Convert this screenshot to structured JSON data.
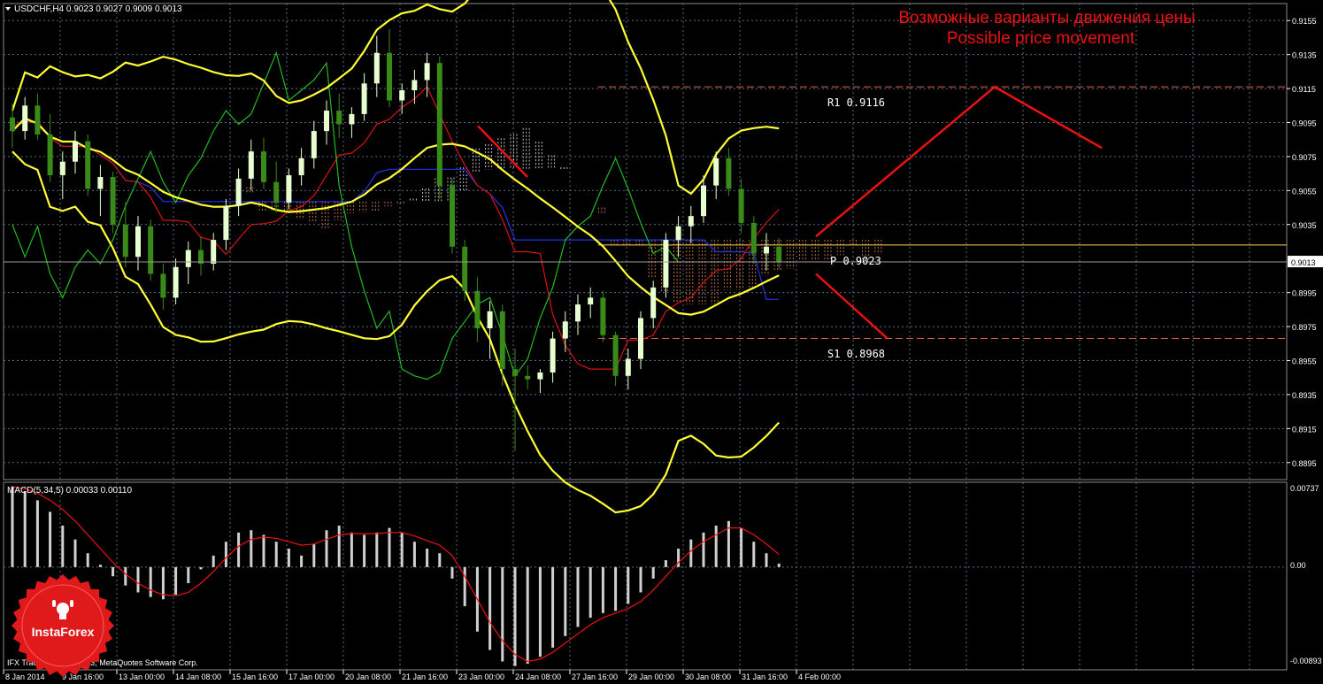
{
  "header": {
    "symbol_info": "USDCHF,H4  0.9023 0.9027 0.9009 0.9013",
    "forecast_title_ru": "Возможные варианты движения цены",
    "forecast_title_en": "Possible price movement"
  },
  "levels": {
    "r1": {
      "label": "R1  0.9116",
      "value": 0.9116
    },
    "pivot": {
      "label": "P  0.9023",
      "value": 0.9023
    },
    "s1": {
      "label": "S1  0.8968",
      "value": 0.8968
    },
    "current": {
      "label": "0.9013",
      "value": 0.9013
    }
  },
  "price_axis": {
    "min": 0.8885,
    "max": 0.9165,
    "ticks": [
      "0.9155",
      "0.9135",
      "0.9115",
      "0.9095",
      "0.9075",
      "0.9055",
      "0.9035",
      "0.8995",
      "0.8975",
      "0.8955",
      "0.8935",
      "0.8915",
      "0.8895"
    ]
  },
  "macd": {
    "label": "MACD(5,34,5) 0.00033 0.00110",
    "axis_top": "0.00737",
    "axis_zero": "0.00",
    "axis_bottom": "-0.00893",
    "max": 0.00737,
    "min": -0.00893
  },
  "time_axis": [
    "8 Jan 2014",
    "9 Jan 16:00",
    "13 Jan 00:00",
    "14 Jan 08:00",
    "15 Jan 16:00",
    "17 Jan 00:00",
    "20 Jan 08:00",
    "21 Jan 16:00",
    "23 Jan 00:00",
    "24 Jan 08:00",
    "27 Jan 16:00",
    "29 Jan 00:00",
    "30 Jan 08:00",
    "31 Jan 16:00",
    "4 Feb 00:00"
  ],
  "footer": {
    "copyright": "IFX Trader, © 2001-2013, MetaQuotes Software Corp."
  },
  "logo": {
    "text": "InstaForex"
  },
  "colors": {
    "background": "#000000",
    "grid": "#5a6a80",
    "bull_candle": "#e8ffd0",
    "bear_candle": "#3a8a1a",
    "bollinger": "#ffff33",
    "tenkan": "#dd1111",
    "kijun": "#2233ee",
    "chikou": "#22bb22",
    "kumo": "#ff9a66",
    "forecast": "#ee1111",
    "pivot_line": "#ffd24d",
    "resistance_support": "#e06040",
    "macd_hist": "#d0d0d0",
    "macd_signal": "#ee1111",
    "logo": "#e01a1a"
  },
  "chart_data": {
    "type": "candlestick",
    "symbol": "USDCHF",
    "timeframe": "H4",
    "ohlc": [
      [
        0.9098,
        0.9106,
        0.908,
        0.909
      ],
      [
        0.909,
        0.911,
        0.9085,
        0.9105
      ],
      [
        0.9105,
        0.9112,
        0.9085,
        0.9088
      ],
      [
        0.9088,
        0.91,
        0.906,
        0.9064
      ],
      [
        0.9064,
        0.9078,
        0.905,
        0.9072
      ],
      [
        0.9072,
        0.909,
        0.9065,
        0.9084
      ],
      [
        0.9084,
        0.9088,
        0.9052,
        0.9056
      ],
      [
        0.9056,
        0.907,
        0.904,
        0.9063
      ],
      [
        0.9063,
        0.9066,
        0.903,
        0.9035
      ],
      [
        0.9035,
        0.9048,
        0.901,
        0.9016
      ],
      [
        0.9016,
        0.904,
        0.9008,
        0.9034
      ],
      [
        0.9034,
        0.9038,
        0.9002,
        0.9006
      ],
      [
        0.9006,
        0.9012,
        0.8985,
        0.8992
      ],
      [
        0.8992,
        0.9015,
        0.8988,
        0.901
      ],
      [
        0.901,
        0.9025,
        0.9,
        0.902
      ],
      [
        0.902,
        0.9028,
        0.9005,
        0.9012
      ],
      [
        0.9012,
        0.903,
        0.9008,
        0.9026
      ],
      [
        0.9026,
        0.905,
        0.902,
        0.9046
      ],
      [
        0.9046,
        0.9068,
        0.904,
        0.9062
      ],
      [
        0.9062,
        0.9085,
        0.9055,
        0.9078
      ],
      [
        0.9078,
        0.9086,
        0.9056,
        0.906
      ],
      [
        0.906,
        0.9072,
        0.9042,
        0.9048
      ],
      [
        0.9048,
        0.9068,
        0.9044,
        0.9064
      ],
      [
        0.9064,
        0.908,
        0.9058,
        0.9074
      ],
      [
        0.9074,
        0.9096,
        0.9068,
        0.909
      ],
      [
        0.909,
        0.9108,
        0.9082,
        0.9102
      ],
      [
        0.9102,
        0.9112,
        0.9086,
        0.9094
      ],
      [
        0.9094,
        0.9104,
        0.9086,
        0.91
      ],
      [
        0.91,
        0.9124,
        0.9096,
        0.9118
      ],
      [
        0.9118,
        0.9146,
        0.911,
        0.9136
      ],
      [
        0.9136,
        0.915,
        0.9104,
        0.9108
      ],
      [
        0.9108,
        0.9118,
        0.91,
        0.9114
      ],
      [
        0.9114,
        0.9126,
        0.9106,
        0.912
      ],
      [
        0.912,
        0.9136,
        0.911,
        0.913
      ],
      [
        0.913,
        0.9134,
        0.905,
        0.9058
      ],
      [
        0.9058,
        0.9062,
        0.9018,
        0.9022
      ],
      [
        0.9022,
        0.9026,
        0.899,
        0.8996
      ],
      [
        0.8996,
        0.9004,
        0.8966,
        0.8974
      ],
      [
        0.8974,
        0.899,
        0.8956,
        0.8984
      ],
      [
        0.8984,
        0.8988,
        0.894,
        0.895
      ],
      [
        0.895,
        0.8962,
        0.8902,
        0.8946
      ],
      [
        0.8946,
        0.8952,
        0.8938,
        0.8944
      ],
      [
        0.8944,
        0.895,
        0.8936,
        0.8948
      ],
      [
        0.8948,
        0.8972,
        0.8942,
        0.8968
      ],
      [
        0.8968,
        0.8984,
        0.896,
        0.8978
      ],
      [
        0.8978,
        0.8994,
        0.897,
        0.8988
      ],
      [
        0.8988,
        0.8998,
        0.898,
        0.8992
      ],
      [
        0.8992,
        0.8996,
        0.8966,
        0.897
      ],
      [
        0.897,
        0.8972,
        0.894,
        0.8946
      ],
      [
        0.8946,
        0.8962,
        0.8938,
        0.8956
      ],
      [
        0.8956,
        0.8984,
        0.895,
        0.898
      ],
      [
        0.898,
        0.9002,
        0.8974,
        0.8998
      ],
      [
        0.8998,
        0.903,
        0.8992,
        0.9026
      ],
      [
        0.9026,
        0.904,
        0.9016,
        0.9034
      ],
      [
        0.9034,
        0.9046,
        0.9024,
        0.904
      ],
      [
        0.904,
        0.9064,
        0.9036,
        0.9058
      ],
      [
        0.9058,
        0.9078,
        0.905,
        0.9074
      ],
      [
        0.9074,
        0.908,
        0.9052,
        0.9056
      ],
      [
        0.9056,
        0.9062,
        0.903,
        0.9036
      ],
      [
        0.9036,
        0.904,
        0.9012,
        0.9018
      ],
      [
        0.9018,
        0.903,
        0.9008,
        0.9022
      ],
      [
        0.9022,
        0.9027,
        0.9009,
        0.9013
      ]
    ],
    "macd_histogram": [
      0.007,
      0.0066,
      0.0058,
      0.0048,
      0.0036,
      0.0024,
      0.0012,
      0.0002,
      -0.0008,
      -0.0016,
      -0.0022,
      -0.0026,
      -0.0028,
      -0.0024,
      -0.0014,
      -0.0002,
      0.001,
      0.0022,
      0.003,
      0.0032,
      0.0028,
      0.0022,
      0.0016,
      0.001,
      0.002,
      0.0032,
      0.0036,
      0.003,
      0.0028,
      0.003,
      0.0034,
      0.003,
      0.0022,
      0.0016,
      0.0012,
      -0.001,
      -0.0034,
      -0.0056,
      -0.0072,
      -0.0082,
      -0.0086,
      -0.0084,
      -0.0078,
      -0.007,
      -0.006,
      -0.0052,
      -0.0044,
      -0.004,
      -0.0038,
      -0.0032,
      -0.0022,
      -0.001,
      0.0006,
      0.0016,
      0.0024,
      0.003,
      0.0036,
      0.004,
      0.0034,
      0.0022,
      0.0012,
      0.0003
    ],
    "macd_signal": [
      0.007,
      0.0068,
      0.0064,
      0.0058,
      0.005,
      0.004,
      0.0028,
      0.0016,
      0.0004,
      -0.0006,
      -0.0014,
      -0.002,
      -0.0024,
      -0.0025,
      -0.0022,
      -0.0014,
      -0.0004,
      0.0008,
      0.0018,
      0.0024,
      0.0026,
      0.0025,
      0.0022,
      0.0019,
      0.002,
      0.0024,
      0.0028,
      0.0029,
      0.0029,
      0.0029,
      0.003,
      0.003,
      0.0027,
      0.0023,
      0.0019,
      0.001,
      -0.0008,
      -0.0028,
      -0.0048,
      -0.0064,
      -0.0076,
      -0.0082,
      -0.008,
      -0.0074,
      -0.0066,
      -0.0058,
      -0.005,
      -0.0044,
      -0.004,
      -0.0036,
      -0.003,
      -0.002,
      -0.0008,
      0.0004,
      0.0014,
      0.0022,
      0.0028,
      0.0034,
      0.0034,
      0.0028,
      0.002,
      0.0011
    ],
    "forecast_paths": [
      {
        "name": "up",
        "points": [
          [
            0.9028,
            0
          ],
          [
            0.9116,
            1
          ],
          [
            0.908,
            1.6
          ]
        ]
      },
      {
        "name": "down",
        "points": [
          [
            0.9006,
            0
          ],
          [
            0.8968,
            1
          ]
        ]
      }
    ]
  }
}
